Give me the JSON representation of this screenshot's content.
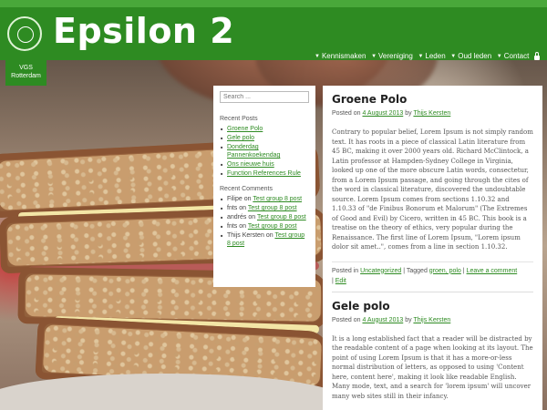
{
  "site": {
    "title": "Epsilon 2",
    "logo_text": "VGS Rotterdam",
    "brand_color": "#2e8b22"
  },
  "nav": [
    {
      "label": "Kennismaken",
      "has_caret": true
    },
    {
      "label": "Vereniging",
      "has_caret": true
    },
    {
      "label": "Leden",
      "has_caret": true
    },
    {
      "label": "Oud leden",
      "has_caret": true
    },
    {
      "label": "Contact",
      "has_caret": true
    }
  ],
  "nav_lock_icon": "lock-icon",
  "sidebar": {
    "search_placeholder": "Search ...",
    "recent_posts_title": "Recent Posts",
    "recent_posts": [
      "Groene Polo",
      "Gele polo",
      "Donderdag Pannenkoekendag",
      "Ons nieuwe huis",
      "Function References Rule"
    ],
    "recent_comments_title": "Recent Comments",
    "recent_comments": [
      {
        "author": "Filipe",
        "on": "on",
        "post": "Test group 8 post"
      },
      {
        "author": "fnts",
        "on": "on",
        "post": "Test group 8 post"
      },
      {
        "author": "andrés",
        "on": "on",
        "post": "Test group 8 post"
      },
      {
        "author": "fnts",
        "on": "on",
        "post": "Test group 8 post"
      },
      {
        "author": "Thijs Kersten",
        "on": "on",
        "post": "Test group 8 post"
      }
    ]
  },
  "posts": [
    {
      "title": "Groene Polo",
      "meta_prefix": "Posted on",
      "date": "4 August 2013",
      "by": "by",
      "author": "Thijs Kersten",
      "body": "Contrary to popular belief, Lorem Ipsum is not simply random text. It has roots in a piece of classical Latin literature from 45 BC, making it over 2000 years old. Richard McClintock, a Latin professor at Hampden-Sydney College in Virginia, looked up one of the more obscure Latin words, consectetur, from a Lorem Ipsum passage, and going through the cites of the word in classical literature, discovered the undoubtable source. Lorem Ipsum comes from sections 1.10.32 and 1.10.33 of \"de Finibus Bonorum et Malorum\" (The Extremes of Good and Evil) by Cicero, written in 45 BC. This book is a treatise on the theory of ethics, very popular during the Renaissance. The first line of Lorem Ipsum, \"Lorem ipsum dolor sit amet..\", comes from a line in section 1.10.32.",
      "posted_in_label": "Posted in",
      "category": "Uncategorized",
      "tagged_label": "Tagged",
      "tags": "groen, polo",
      "comment_link": "Leave a comment",
      "edit_link": "Edit"
    },
    {
      "title": "Gele polo",
      "meta_prefix": "Posted on",
      "date": "4 August 2013",
      "by": "by",
      "author": "Thijs Kersten",
      "body": "It is a long established fact that a reader will be distracted by the readable content of a page when looking at its layout. The point of using Lorem Ipsum is that it has a more-or-less normal distribution of letters, as opposed to using 'Content here, content here', making it look like readable English. Many mode, text, and a search for 'lorem ipsum' will uncover many web sites still in their infancy."
    }
  ]
}
